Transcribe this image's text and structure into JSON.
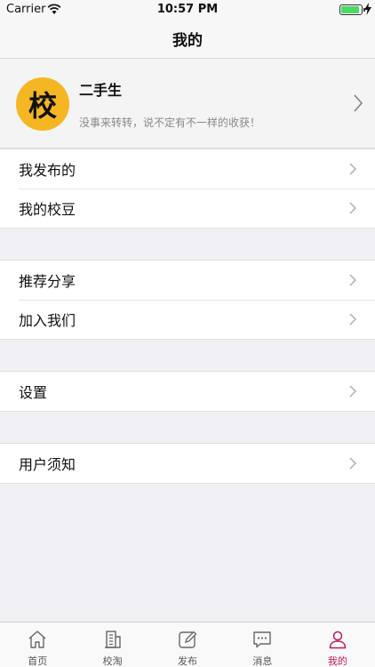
{
  "status_bar": {
    "carrier": "Carrier",
    "time": "10:57 PM"
  },
  "nav": {
    "title": "我的"
  },
  "profile": {
    "avatar_text": "校",
    "name": "二手生",
    "motto": "没事来转转，说不定有不一样的收获！"
  },
  "groups": [
    {
      "items": [
        {
          "label": "我发布的"
        },
        {
          "label": "我的校豆"
        }
      ]
    },
    {
      "items": [
        {
          "label": "推荐分享"
        },
        {
          "label": "加入我们"
        }
      ]
    },
    {
      "items": [
        {
          "label": "设置"
        }
      ]
    },
    {
      "items": [
        {
          "label": "用户须知"
        }
      ]
    }
  ],
  "tabs": [
    {
      "label": "首页",
      "icon": "home-icon"
    },
    {
      "label": "校淘",
      "icon": "building-icon"
    },
    {
      "label": "发布",
      "icon": "edit-icon"
    },
    {
      "label": "消息",
      "icon": "message-icon"
    },
    {
      "label": "我的",
      "icon": "person-icon",
      "active": true
    }
  ],
  "colors": {
    "accent": "#c2185b",
    "avatar": "#f5b623",
    "battery": "#4cd964"
  }
}
